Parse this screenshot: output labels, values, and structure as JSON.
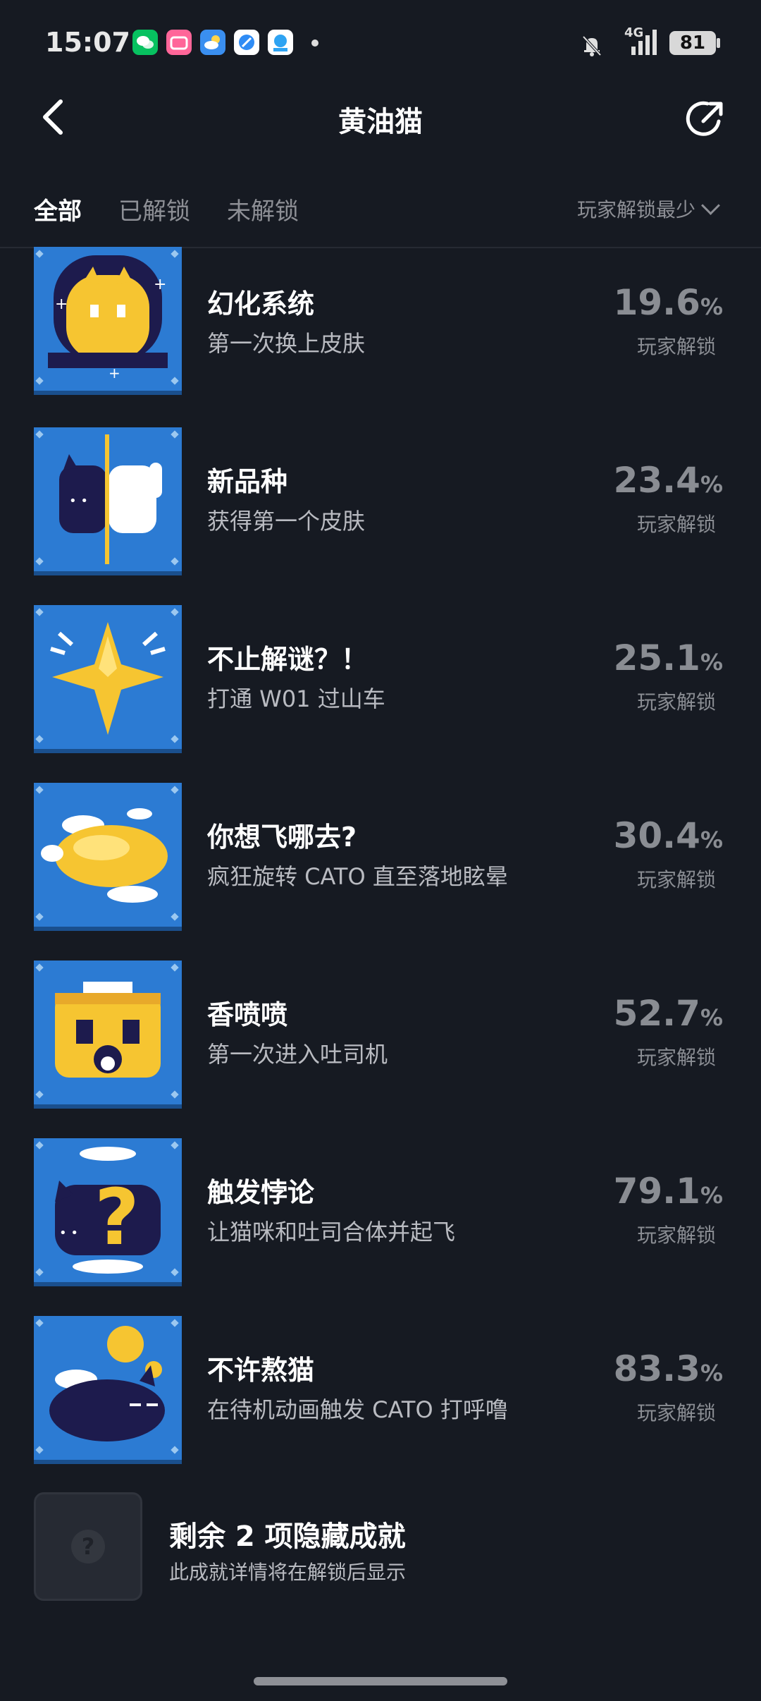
{
  "status_bar": {
    "time": "15:07",
    "network": "4G",
    "battery": "81",
    "icons": [
      "wechat-icon",
      "bilibili-icon",
      "weather-icon",
      "browser-icon",
      "app-icon",
      "mute-icon",
      "signal-icon",
      "battery-icon"
    ]
  },
  "header": {
    "title": "黄油猫",
    "back_icon": "back-arrow-icon",
    "share_icon": "share-icon"
  },
  "tabs": [
    {
      "label": "全部",
      "active": true
    },
    {
      "label": "已解锁",
      "active": false
    },
    {
      "label": "未解锁",
      "active": false
    }
  ],
  "sort": {
    "label": "玩家解锁最少"
  },
  "achievements": [
    {
      "title": "幻化系统",
      "desc": "第一次换上皮肤",
      "percent": "19.6",
      "unit": "%",
      "label": "玩家解锁",
      "icon": "cat-portal-icon"
    },
    {
      "title": "新品种",
      "desc": "获得第一个皮肤",
      "percent": "23.4",
      "unit": "%",
      "label": "玩家解锁",
      "icon": "half-cat-icon"
    },
    {
      "title": "不止解谜？！",
      "desc": "打通 W01 过山车",
      "percent": "25.1",
      "unit": "%",
      "label": "玩家解锁",
      "icon": "star-sparkle-icon"
    },
    {
      "title": "你想飞哪去?",
      "desc": "疯狂旋转 CATO 直至落地眩晕",
      "percent": "30.4",
      "unit": "%",
      "label": "玩家解锁",
      "icon": "flying-cloud-icon"
    },
    {
      "title": "香喷喷",
      "desc": "第一次进入吐司机",
      "percent": "52.7",
      "unit": "%",
      "label": "玩家解锁",
      "icon": "toaster-icon"
    },
    {
      "title": "触发悖论",
      "desc": "让猫咪和吐司合体并起飞",
      "percent": "79.1",
      "unit": "%",
      "label": "玩家解锁",
      "icon": "question-cat-icon"
    },
    {
      "title": "不许熬猫",
      "desc": "在待机动画触发 CATO 打呼噜",
      "percent": "83.3",
      "unit": "%",
      "label": "玩家解锁",
      "icon": "sleeping-cat-icon"
    }
  ],
  "hidden": {
    "title": "剩余 2 项隐藏成就",
    "desc": "此成就详情将在解锁后显示",
    "icon": "question-icon"
  },
  "colors": {
    "background": "#161a22",
    "tile_blue": "#2c7bd3",
    "muted_text": "#8a8d93",
    "yellow": "#f6c531",
    "cat_navy": "#1d1b4d"
  }
}
